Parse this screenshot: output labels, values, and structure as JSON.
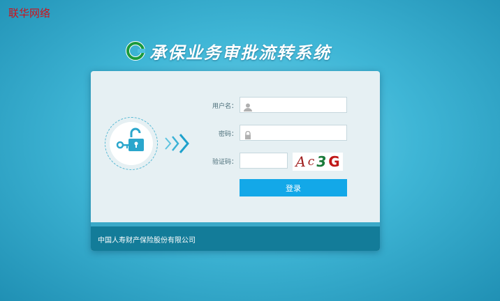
{
  "corner_text": "联华网络",
  "header": {
    "title": "承保业务审批流转系统",
    "logo_icon": "picc-logo-icon"
  },
  "form": {
    "username_label": "用户名：",
    "password_label": "密码：",
    "captcha_label": "验证码：",
    "username_value": "",
    "password_value": "",
    "captcha_value": "",
    "captcha_chars": [
      "A",
      "c",
      "3",
      "G"
    ],
    "login_label": "登录"
  },
  "footer": {
    "company": "中国人寿财产保险股份有限公司"
  },
  "colors": {
    "accent": "#13a8e8",
    "footer": "#137c99",
    "logo": "#1a9a3c"
  }
}
